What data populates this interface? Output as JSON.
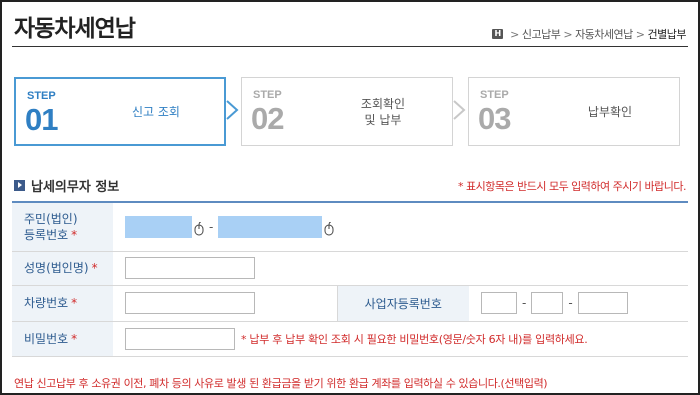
{
  "page": {
    "title": "자동차세연납",
    "breadcrumb": {
      "home_icon_text": "H",
      "items": [
        "신고납부",
        "자동차세연납",
        "건별납부"
      ],
      "separator": ">"
    }
  },
  "steps": [
    {
      "word": "STEP",
      "number": "01",
      "label": "신고 조회",
      "active": true
    },
    {
      "word": "STEP",
      "number": "02",
      "label_line1": "조회확인",
      "label_line2": "및 납부",
      "active": false
    },
    {
      "word": "STEP",
      "number": "03",
      "label": "납부확인",
      "active": false
    }
  ],
  "section": {
    "title": "납세의무자 정보",
    "required_note": "* 표시항목은 반드시 모두 입력하여 주시기 바랍니다."
  },
  "form": {
    "rrn": {
      "label_line1": "주민(법인)",
      "label_line2": "등록번호",
      "required_mark": "*",
      "value1": "",
      "value2": "",
      "dash": "-",
      "icon": "mouse-icon"
    },
    "name": {
      "label": "성명(법인명)",
      "required_mark": "*",
      "value": ""
    },
    "car_no": {
      "label": "차량번호",
      "required_mark": "*",
      "value": ""
    },
    "biz_no": {
      "label": "사업자등록번호",
      "dash": "-",
      "value1": "",
      "value2": "",
      "value3": ""
    },
    "password": {
      "label": "비밀번호",
      "required_mark": "*",
      "value": "",
      "note": "* 납부 후 납부 확인 조회 시 필요한 비밀번호(영문/숫자 6자 내)를 입력하세요."
    }
  },
  "bottom_note": "연납 신고납부 후 소유권 이전, 폐차 등의 사유로 발생 된 환급금을 받기 위한 환급 계좌를 입력하실 수 있습니다.(선택입력)",
  "colors": {
    "accent": "#2f7fc3",
    "required": "#d12b2b",
    "header_bg": "#eef3f8",
    "filled_input": "#a9d0f5"
  }
}
